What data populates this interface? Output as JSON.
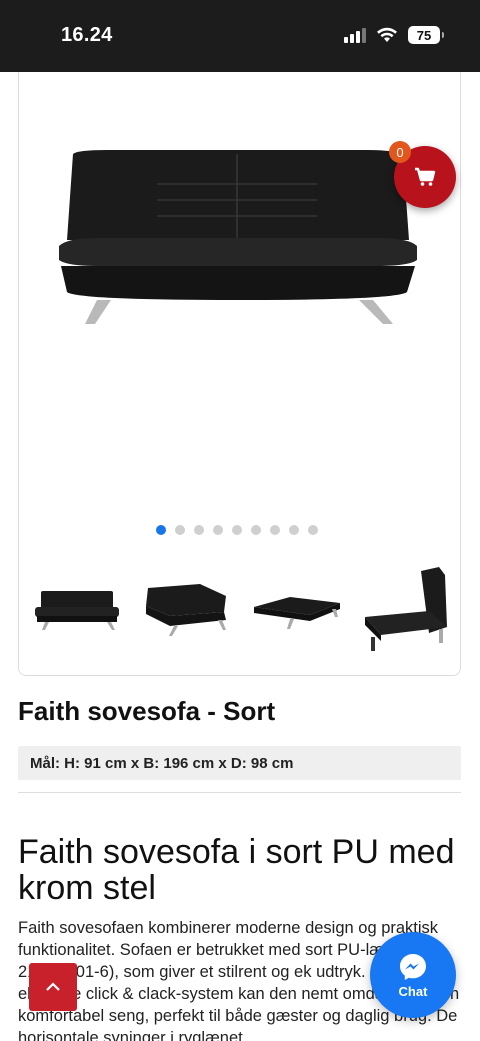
{
  "status_bar": {
    "time": "16.24",
    "battery": "75"
  },
  "cart": {
    "count": "0"
  },
  "gallery": {
    "dot_count": 9,
    "active_dot": 0
  },
  "product": {
    "title": "Faith sovesofa - Sort",
    "dimensions": "Mål: H: 91 cm x B: 196 cm x D: 98 cm"
  },
  "description": {
    "heading": "Faith sovesofa i sort PU med krom stel",
    "text": "Faith sovesofaen kombinerer moderne design og praktisk funktionalitet. Sofaen er betrukket med sort PU-læder (ku 21229D01-6), som giver et stilrent og ek udtryk. Med sit elegante click & clack-system kan den nemt omdannes til en komfortabel seng, perfekt til både gæster og daglig brug. De horisontale syninger i ryglænet"
  },
  "chat": {
    "label": "Chat"
  },
  "colors": {
    "cart_red": "#b8121d",
    "accent_blue": "#1877f2",
    "scroll_red": "#c9212b"
  },
  "icons": [
    "signal-icon",
    "wifi-icon",
    "battery-icon",
    "cart-icon",
    "chevron-up-icon",
    "messenger-icon"
  ]
}
